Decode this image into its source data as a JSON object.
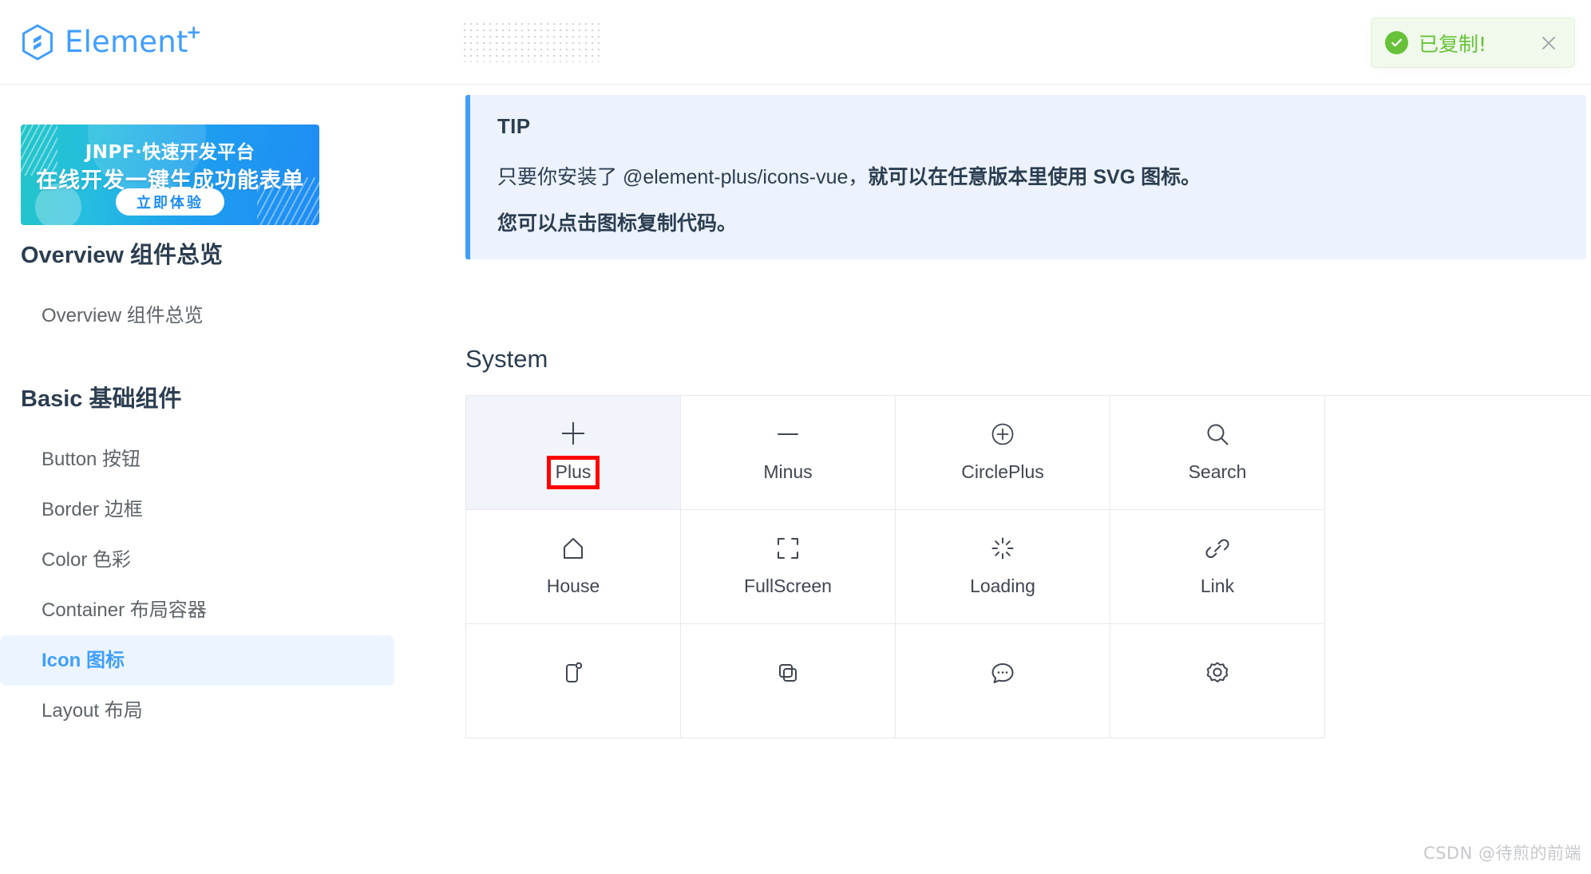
{
  "header": {
    "brand_name": "Element",
    "brand_superscript": "+",
    "logo_icon": "element-plus-hexagon-logo"
  },
  "toast": {
    "message": "已复制!",
    "status_icon": "success-check-circle-icon",
    "close_icon": "close-icon",
    "color": "#67c23a",
    "background": "#f0f9eb"
  },
  "sidebar": {
    "ad": {
      "brand": "JNPF",
      "brand_suffix": "·快速开发平台",
      "headline": "在线开发一键生成功能表单",
      "cta": "立即体验"
    },
    "groups": [
      {
        "title": "Overview 组件总览",
        "items": [
          {
            "label": "Overview 组件总览",
            "active": false
          }
        ]
      },
      {
        "title": "Basic 基础组件",
        "items": [
          {
            "label": "Button 按钮",
            "active": false
          },
          {
            "label": "Border 边框",
            "active": false
          },
          {
            "label": "Color 色彩",
            "active": false
          },
          {
            "label": "Container 布局容器",
            "active": false
          },
          {
            "label": "Icon 图标",
            "active": true
          },
          {
            "label": "Layout 布局",
            "active": false
          }
        ]
      }
    ],
    "active_item_bg": "#ecf5ff",
    "active_item_color": "#409eff"
  },
  "main": {
    "tip": {
      "title": "TIP",
      "paragraph_1_plain": "只要你安装了 @element-plus/icons-vue，",
      "paragraph_1_bold": "就可以在任意版本里使用 SVG 图标。",
      "paragraph_2_bold": "您可以点击图标复制代码。",
      "accent_color": "#409eff",
      "background": "#ecf3ff"
    },
    "section_title": "System",
    "icons": [
      {
        "name": "Plus",
        "icon": "plus-icon",
        "hovered": true,
        "annotated": true
      },
      {
        "name": "Minus",
        "icon": "minus-icon",
        "hovered": false,
        "annotated": false
      },
      {
        "name": "CirclePlus",
        "icon": "circle-plus-icon",
        "hovered": false,
        "annotated": false
      },
      {
        "name": "Search",
        "icon": "search-icon",
        "hovered": false,
        "annotated": false
      },
      {
        "name": "House",
        "icon": "house-icon",
        "hovered": false,
        "annotated": false
      },
      {
        "name": "FullScreen",
        "icon": "full-screen-icon",
        "hovered": false,
        "annotated": false
      },
      {
        "name": "Loading",
        "icon": "loading-icon",
        "hovered": false,
        "annotated": false
      },
      {
        "name": "Link",
        "icon": "link-icon",
        "hovered": false,
        "annotated": false
      },
      {
        "name": "",
        "icon": "bell-icon",
        "hovered": false,
        "annotated": false
      },
      {
        "name": "",
        "icon": "copy-document-icon",
        "hovered": false,
        "annotated": false
      },
      {
        "name": "",
        "icon": "chat-round-icon",
        "hovered": false,
        "annotated": false
      },
      {
        "name": "",
        "icon": "setting-gear-icon",
        "hovered": false,
        "annotated": false
      }
    ],
    "annotation_color": "#ff0000"
  },
  "watermark": "CSDN @待煎的前端"
}
